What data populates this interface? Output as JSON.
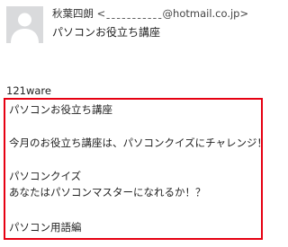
{
  "header": {
    "sender_name": "秋葉四朗",
    "sender_address": "<ˍˍˍˍˍˍˍˍˍˍˍ@hotmail.co.jp>",
    "subject": "パソコンお役立ち講座"
  },
  "body": {
    "from_line": "121ware",
    "lines": [
      "パソコンお役立ち講座",
      "今月のお役立ち講座は、パソコンクイズにチャレンジ！",
      "パソコンクイズ",
      "あなたはパソコンマスターになれるか！？",
      "パソコン用語編"
    ]
  },
  "colors": {
    "highlight_border": "#e60012",
    "avatar_bg": "#d9dadc"
  },
  "icons": {
    "avatar": "person-silhouette-icon"
  }
}
